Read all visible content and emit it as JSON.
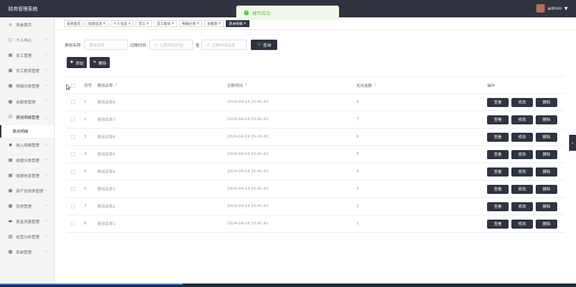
{
  "app": {
    "title": "财务管理系统"
  },
  "header": {
    "username": "admin"
  },
  "toast": {
    "message": "操作成功"
  },
  "sidebar": {
    "items": [
      {
        "label": "系统首页",
        "icon": "home-icon",
        "glyph": "⌂"
      },
      {
        "label": "个人中心",
        "icon": "user-card-icon",
        "glyph": "▢",
        "arrow": true
      },
      {
        "label": "员工管理",
        "icon": "grid-icon",
        "glyph": "▦",
        "arrow": true
      },
      {
        "label": "员工薪资管理",
        "icon": "grid-icon",
        "glyph": "▦",
        "arrow": true
      },
      {
        "label": "明细分类管理",
        "icon": "grid-icon",
        "glyph": "▦",
        "arrow": true
      },
      {
        "label": "余额表管理",
        "icon": "grid-icon",
        "glyph": "▦",
        "arrow": true
      },
      {
        "label": "费用明细管理",
        "icon": "checkbox-icon",
        "glyph": "☑",
        "arrow": true,
        "open": true
      },
      {
        "label": "收入明细管理",
        "icon": "person-icon",
        "glyph": "◉",
        "arrow": true
      },
      {
        "label": "收据分类管理",
        "icon": "grid-icon",
        "glyph": "▦",
        "arrow": true
      },
      {
        "label": "收据信息管理",
        "icon": "grid-icon",
        "glyph": "▦",
        "arrow": true
      },
      {
        "label": "资产负债表管理",
        "icon": "grid-icon",
        "glyph": "▦",
        "arrow": true
      },
      {
        "label": "负债管理",
        "icon": "grid-icon",
        "glyph": "▦",
        "arrow": true
      },
      {
        "label": "现金流量管理",
        "icon": "chat-icon",
        "glyph": "▬",
        "arrow": true
      },
      {
        "label": "经营分析管理",
        "icon": "bar-chart-icon",
        "glyph": "▥",
        "arrow": true
      },
      {
        "label": "系统管理",
        "icon": "grid-icon",
        "glyph": "▦",
        "arrow": true
      }
    ],
    "sub_item": "费用明细"
  },
  "tags": [
    {
      "label": "系统首页",
      "closable": false
    },
    {
      "label": "收款信息",
      "closable": true
    },
    {
      "label": "个人信息",
      "closable": true
    },
    {
      "label": "员工",
      "closable": true
    },
    {
      "label": "员工薪资",
      "closable": true
    },
    {
      "label": "明细分类",
      "closable": true
    },
    {
      "label": "余额表",
      "closable": true
    },
    {
      "label": "费用明细",
      "closable": true,
      "active": true
    }
  ],
  "search": {
    "name_label": "费用名称",
    "name_placeholder": "费用名称",
    "time_label": "记账时间",
    "start_placeholder": "记账时间开始",
    "range_sep": "至",
    "end_placeholder": "记账时间结束",
    "query_button": "查询"
  },
  "actions": {
    "add": "添加",
    "delete": "删除"
  },
  "table": {
    "columns": {
      "index": "序号",
      "name": "费用名称",
      "time": "记账时间",
      "amount": "支出金额",
      "ops": "操作"
    },
    "rows": [
      {
        "index": "1",
        "name": "费用名称8",
        "time": "2024-04-24 15:41:41",
        "amount": "8"
      },
      {
        "index": "2",
        "name": "费用名称7",
        "time": "2024-04-24 15:41:41",
        "amount": "7"
      },
      {
        "index": "3",
        "name": "费用名称6",
        "time": "2024-04-24 15:41:41",
        "amount": "6"
      },
      {
        "index": "4",
        "name": "费用名称5",
        "time": "2024-04-24 15:41:41",
        "amount": "5"
      },
      {
        "index": "5",
        "name": "费用名称4",
        "time": "2024-04-24 15:41:41",
        "amount": "4"
      },
      {
        "index": "6",
        "name": "费用名称3",
        "time": "2024-04-24 15:41:41",
        "amount": "3"
      },
      {
        "index": "7",
        "name": "费用名称2",
        "time": "2024-04-24 15:41:41",
        "amount": "2"
      },
      {
        "index": "8",
        "name": "费用名称1",
        "time": "2024-04-24 15:41:41",
        "amount": "1"
      }
    ],
    "row_buttons": {
      "view": "查看",
      "edit": "修改",
      "delete": "删除"
    }
  },
  "colors": {
    "primary_dark": "#2f3440",
    "success": "#67c23a"
  }
}
